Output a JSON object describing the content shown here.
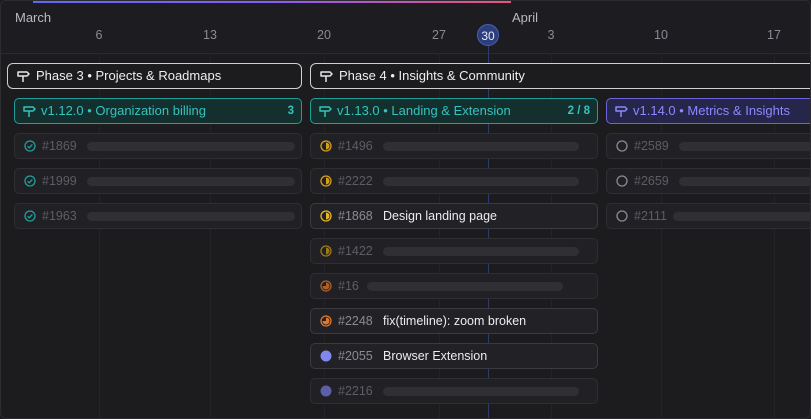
{
  "timeline": {
    "months": [
      "March",
      "April"
    ],
    "days": [
      "6",
      "13",
      "20",
      "27",
      "3",
      "10",
      "17"
    ],
    "today": "30"
  },
  "phases": [
    {
      "label": "Phase 3 • Projects & Roadmaps"
    },
    {
      "label": "Phase 4 • Insights & Community"
    }
  ],
  "releases": [
    {
      "label": "v1.12.0 • Organization billing",
      "count": "3",
      "color": "#35c3bc"
    },
    {
      "label": "v1.13.0 • Landing & Extension",
      "count": "2 / 8",
      "color": "#35c3bc"
    },
    {
      "label": "v1.14.0 • Metrics & Insights",
      "count": "",
      "color": "#8f87ff"
    }
  ],
  "issues": {
    "col1": [
      {
        "num": "#1869",
        "status": "done"
      },
      {
        "num": "#1999",
        "status": "done"
      },
      {
        "num": "#1963",
        "status": "done"
      }
    ],
    "col2": [
      {
        "num": "#1496",
        "status": "in-progress-half"
      },
      {
        "num": "#2222",
        "status": "in-progress-half"
      },
      {
        "num": "#1868",
        "status": "in-progress-half",
        "title": "Design landing page"
      },
      {
        "num": "#1422",
        "status": "in-progress-half"
      },
      {
        "num": "#16",
        "status": "in-progress-most"
      },
      {
        "num": "#2248",
        "status": "in-progress-most",
        "title": "fix(timeline): zoom broken"
      },
      {
        "num": "#2055",
        "status": "ready",
        "title": "Browser Extension"
      },
      {
        "num": "#2216",
        "status": "ready"
      }
    ],
    "col3": [
      {
        "num": "#2589",
        "status": "todo"
      },
      {
        "num": "#2659",
        "status": "todo"
      },
      {
        "num": "#2111",
        "status": "todo"
      }
    ]
  },
  "colors": {
    "done": "#1f9e9a",
    "in_progress": "#d4a017",
    "in_progress_orange": "#e0782e",
    "ready": "#8088f0",
    "today_ring": "#4a61b8"
  }
}
